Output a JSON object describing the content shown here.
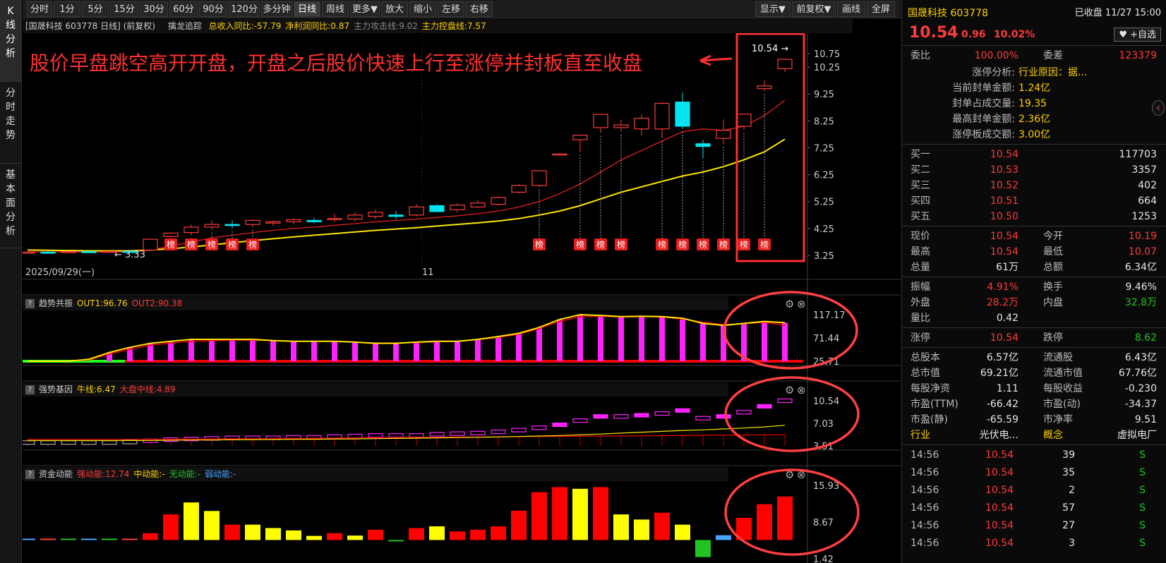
{
  "left_tabs": [
    "K线分析",
    "分时走势",
    "基本面分析"
  ],
  "toolbar": {
    "left": [
      "分时",
      "1分",
      "5分",
      "15分",
      "30分",
      "60分",
      "90分",
      "120分",
      "多分钟",
      "日线",
      "周线",
      "更多▼",
      "放大",
      "缩小",
      "左移",
      "右移"
    ],
    "active": "日线",
    "right": [
      "显示▼",
      "前复权▼",
      "画线",
      "全屏"
    ]
  },
  "main_panel": {
    "title": "[国晟科技 603778 日线] (前复权)",
    "indicator_name": "擒龙追踪",
    "stats": [
      {
        "text": "总收入同比:-57.79",
        "color": "#ffd200"
      },
      {
        "text": "净利润同比:0.87",
        "color": "#ffd200"
      },
      {
        "text": "主力攻击线:9.02",
        "color": "#888888"
      },
      {
        "text": "主力控盘线:7.57",
        "color": "#ffd200"
      }
    ],
    "y_ticks": [
      "10.75",
      "10.25",
      "9.25",
      "8.25",
      "7.25",
      "6.25",
      "5.25",
      "4.25",
      "3.25"
    ],
    "x_labels": [
      "2025/09/29(一)",
      "11"
    ],
    "annotation": "股价早盘跳空高开开盘，开盘之后股价快速上行至涨停并封板直至收盘",
    "price_high_label": "10.54",
    "price_low_label": "3.33",
    "bang_label": "榜"
  },
  "sub_panels": [
    {
      "name": "趋势共振",
      "values": [
        {
          "text": "OUT1:96.76",
          "color": "#ffd200"
        },
        {
          "text": "OUT2:90.38",
          "color": "#ff3b3b"
        }
      ],
      "y_ticks": [
        "117.17",
        "71.44",
        "25.71"
      ]
    },
    {
      "name": "强势基因",
      "values": [
        {
          "text": "牛线:6.47",
          "color": "#ffd200"
        },
        {
          "text": "大盘中线:4.89",
          "color": "#ff3b3b"
        }
      ],
      "y_ticks": [
        "10.54",
        "7.03",
        "3.51"
      ]
    },
    {
      "name": "资金动能",
      "values": [
        {
          "text": "强动能:12.74",
          "color": "#ff3b3b"
        },
        {
          "text": "中动能:-",
          "color": "#ffd200"
        },
        {
          "text": "无动能:-",
          "color": "#21c521"
        },
        {
          "text": "弱动能:-",
          "color": "#4aa3ff"
        }
      ],
      "y_ticks": [
        "15.93",
        "8.67",
        "1.42"
      ]
    }
  ],
  "chart_data": {
    "type": "candlestick",
    "ylim": [
      3.25,
      10.75
    ],
    "candles": [
      [
        3.35,
        3.38,
        3.33,
        3.37
      ],
      [
        3.37,
        3.41,
        3.34,
        3.36
      ],
      [
        3.36,
        3.4,
        3.34,
        3.39
      ],
      [
        3.39,
        3.42,
        3.35,
        3.38
      ],
      [
        3.38,
        3.42,
        3.33,
        3.4
      ],
      [
        3.4,
        3.45,
        3.35,
        3.38
      ],
      [
        3.45,
        3.85,
        3.42,
        3.85
      ],
      [
        3.95,
        4.1,
        3.9,
        4.08
      ],
      [
        4.1,
        4.4,
        4.0,
        4.3
      ],
      [
        4.3,
        4.55,
        4.2,
        4.4
      ],
      [
        4.4,
        4.55,
        4.25,
        4.38
      ],
      [
        4.4,
        4.6,
        4.3,
        4.55
      ],
      [
        4.45,
        4.55,
        4.35,
        4.5
      ],
      [
        4.5,
        4.62,
        4.4,
        4.58
      ],
      [
        4.55,
        4.65,
        4.45,
        4.5
      ],
      [
        4.58,
        4.8,
        4.5,
        4.62
      ],
      [
        4.6,
        4.85,
        4.5,
        4.75
      ],
      [
        4.7,
        4.95,
        4.6,
        4.85
      ],
      [
        4.75,
        4.9,
        4.6,
        4.7
      ],
      [
        4.75,
        5.15,
        4.7,
        5.05
      ],
      [
        5.1,
        5.15,
        4.85,
        4.88
      ],
      [
        4.95,
        5.2,
        4.85,
        5.12
      ],
      [
        5.05,
        5.3,
        5.0,
        5.2
      ],
      [
        5.15,
        5.45,
        5.1,
        5.4
      ],
      [
        5.6,
        5.9,
        5.55,
        5.85
      ],
      [
        5.85,
        6.4,
        5.8,
        6.4
      ],
      [
        6.98,
        7.05,
        6.98,
        7.02
      ],
      [
        7.55,
        7.7,
        7.1,
        7.72
      ],
      [
        8.0,
        8.45,
        7.8,
        8.49
      ],
      [
        8.0,
        8.3,
        7.85,
        8.1
      ],
      [
        7.95,
        8.5,
        7.7,
        8.35
      ],
      [
        7.95,
        8.95,
        7.6,
        8.9
      ],
      [
        8.95,
        9.3,
        7.95,
        8.05
      ],
      [
        7.4,
        7.55,
        6.85,
        7.3
      ],
      [
        7.6,
        8.3,
        7.4,
        7.9
      ],
      [
        8.05,
        8.5,
        7.9,
        8.5
      ],
      [
        9.45,
        9.75,
        9.35,
        9.55
      ],
      [
        10.19,
        10.54,
        10.07,
        10.54
      ]
    ],
    "ma_red": [
      3.38,
      3.38,
      3.38,
      3.38,
      3.38,
      3.38,
      3.45,
      3.6,
      3.75,
      3.9,
      4.0,
      4.1,
      4.18,
      4.25,
      4.3,
      4.37,
      4.43,
      4.5,
      4.55,
      4.6,
      4.66,
      4.72,
      4.8,
      4.9,
      5.05,
      5.25,
      5.55,
      5.9,
      6.35,
      6.8,
      7.15,
      7.5,
      7.85,
      7.95,
      7.9,
      8.05,
      8.45,
      9.02
    ],
    "ma_yellow": [
      3.45,
      3.44,
      3.43,
      3.42,
      3.42,
      3.42,
      3.45,
      3.5,
      3.56,
      3.64,
      3.72,
      3.8,
      3.87,
      3.94,
      4.0,
      4.06,
      4.12,
      4.18,
      4.23,
      4.28,
      4.34,
      4.4,
      4.46,
      4.53,
      4.62,
      4.75,
      4.9,
      5.1,
      5.35,
      5.6,
      5.8,
      6.0,
      6.2,
      6.35,
      6.55,
      6.8,
      7.1,
      7.57
    ],
    "bang_indices": [
      7,
      8,
      9,
      10,
      11,
      25,
      27,
      28,
      29,
      31,
      32,
      33,
      34,
      35,
      36
    ],
    "trend_bars": [
      0,
      0,
      0,
      0,
      0,
      0,
      0,
      22,
      35,
      45,
      50,
      55,
      55,
      55,
      55,
      52,
      50,
      50,
      50,
      48,
      45,
      45,
      48,
      50,
      50,
      55,
      62,
      70,
      85,
      105,
      117,
      115,
      112,
      113,
      112,
      108,
      95,
      90,
      95,
      100,
      96.76
    ],
    "trend_out1": [
      0,
      0,
      0,
      0,
      0,
      0,
      5,
      22,
      35,
      45,
      50,
      55,
      55,
      55,
      55,
      52,
      50,
      50,
      50,
      48,
      45,
      45,
      48,
      50,
      50,
      55,
      62,
      70,
      85,
      105,
      117,
      115,
      112,
      113,
      112,
      108,
      95,
      90,
      95,
      100,
      96.76
    ],
    "trend_out2": [
      0,
      0,
      0,
      0,
      0,
      0,
      3,
      18,
      30,
      40,
      46,
      50,
      52,
      53,
      53,
      52,
      50,
      50,
      50,
      48,
      46,
      46,
      47,
      49,
      50,
      54,
      60,
      68,
      82,
      100,
      112,
      113,
      111,
      112,
      111,
      106,
      98,
      92,
      94,
      98,
      90.38
    ],
    "gene_bars": [
      3.5,
      3.5,
      3.5,
      3.5,
      3.5,
      3.6,
      3.8,
      4.0,
      4.1,
      4.2,
      4.3,
      4.3,
      4.3,
      4.4,
      4.4,
      4.5,
      4.6,
      4.7,
      4.7,
      4.7,
      4.9,
      5.0,
      5.1,
      5.3,
      5.6,
      6.0,
      6.5,
      7.2,
      7.9,
      7.9,
      8.1,
      8.4,
      8.9,
      7.6,
      7.9,
      8.6,
      9.6,
      10.54
    ],
    "gene_bull": [
      3.9,
      3.9,
      3.9,
      3.9,
      3.9,
      3.9,
      3.9,
      3.95,
      3.98,
      4.0,
      4.03,
      4.06,
      4.08,
      4.1,
      4.12,
      4.15,
      4.18,
      4.22,
      4.26,
      4.3,
      4.35,
      4.4,
      4.45,
      4.5,
      4.58,
      4.66,
      4.75,
      4.85,
      5.0,
      5.15,
      5.3,
      5.45,
      5.6,
      5.7,
      5.85,
      6.0,
      6.2,
      6.47
    ],
    "gene_mid": [
      4.1,
      4.1,
      4.1,
      4.1,
      4.1,
      4.1,
      4.1,
      4.12,
      4.15,
      4.17,
      4.2,
      4.22,
      4.25,
      4.27,
      4.3,
      4.32,
      4.35,
      4.38,
      4.4,
      4.43,
      4.45,
      4.48,
      4.5,
      4.52,
      4.55,
      4.58,
      4.6,
      4.62,
      4.65,
      4.68,
      4.7,
      4.72,
      4.75,
      4.78,
      4.8,
      4.83,
      4.86,
      4.89
    ],
    "flow_bars": [
      0.4,
      0.4,
      0.4,
      0.4,
      0.4,
      0.4,
      2,
      7.5,
      11,
      8.5,
      4.5,
      4.5,
      3.5,
      2.8,
      1.2,
      2,
      1.3,
      3,
      0,
      3.5,
      4,
      2.5,
      3,
      4,
      8.6,
      14,
      15.5,
      15,
      15.5,
      7.5,
      6,
      8,
      4.5,
      -5,
      1.4,
      6.5,
      10.5,
      12.74
    ],
    "flow_colors": [
      "#4aa3ff",
      "#ff3b3b",
      "#21c521",
      "#4aa3ff",
      "#21c521",
      "#ff3b3b",
      "#ff0000",
      "#ff0000",
      "#ffff00",
      "#ffff00",
      "#ff0000",
      "#ffff00",
      "#ffff00",
      "#ffff00",
      "#ffff00",
      "#ff0000",
      "#ffff00",
      "#ff0000",
      "#21c521",
      "#ff0000",
      "#ffff00",
      "#ff0000",
      "#ff0000",
      "#ff0000",
      "#ff0000",
      "#ff0000",
      "#ff0000",
      "#ffff00",
      "#ff0000",
      "#ffff00",
      "#ffff00",
      "#ff0000",
      "#ffff00",
      "#21c521",
      "#4aa3ff",
      "#ff0000",
      "#ff0000",
      "#ff0000"
    ]
  },
  "right_panel": {
    "title": "国晟科技 603778",
    "status": "已收盘 11/27 15:00",
    "price": "10.54",
    "change": "0.96",
    "pct": "10.02%",
    "watch_btn": "+自选",
    "weibi_label": "委比",
    "weibi": "100.00%",
    "weicha_label": "委差",
    "weicha": "123379",
    "limit_analysis": [
      {
        "label": "涨停分析:",
        "value": "行业原因：据..."
      },
      {
        "label": "当前封单金额:",
        "value": "1.24亿"
      },
      {
        "label": "封单占成交量:",
        "value": "19.35"
      },
      {
        "label": "最高封单金额:",
        "value": "2.36亿"
      },
      {
        "label": "涨停板成交额:",
        "value": "3.00亿"
      }
    ],
    "bids": [
      {
        "label": "买一",
        "price": "10.54",
        "vol": "117703"
      },
      {
        "label": "买二",
        "price": "10.53",
        "vol": "3357"
      },
      {
        "label": "买三",
        "price": "10.52",
        "vol": "402"
      },
      {
        "label": "买四",
        "price": "10.51",
        "vol": "664"
      },
      {
        "label": "买五",
        "price": "10.50",
        "vol": "1253"
      }
    ],
    "quote": [
      {
        "l1": "现价",
        "v1": "10.54",
        "c1": "red",
        "l2": "今开",
        "v2": "10.19",
        "c2": "red"
      },
      {
        "l1": "最高",
        "v1": "10.54",
        "c1": "red",
        "l2": "最低",
        "v2": "10.07",
        "c2": "red"
      },
      {
        "l1": "总量",
        "v1": "61万",
        "c1": "wht",
        "l2": "总额",
        "v2": "6.34亿",
        "c2": "wht"
      }
    ],
    "quote2": [
      {
        "l1": "振幅",
        "v1": "4.91%",
        "c1": "red",
        "l2": "换手",
        "v2": "9.46%",
        "c2": "wht"
      },
      {
        "l1": "外盘",
        "v1": "28.2万",
        "c1": "red",
        "l2": "内盘",
        "v2": "32.8万",
        "c2": "green"
      },
      {
        "l1": "量比",
        "v1": "0.42",
        "c1": "wht",
        "l2": "",
        "v2": "",
        "c2": "wht"
      }
    ],
    "limit_row": {
      "l1": "涨停",
      "v1": "10.54",
      "l2": "跌停",
      "v2": "8.62"
    },
    "fund": [
      {
        "l1": "总股本",
        "v1": "6.57亿",
        "l2": "流通股",
        "v2": "6.43亿"
      },
      {
        "l1": "总市值",
        "v1": "69.21亿",
        "l2": "流通市值",
        "v2": "67.76亿"
      },
      {
        "l1": "每股净资",
        "v1": "1.11",
        "l2": "每股收益",
        "v2": "-0.230"
      },
      {
        "l1": "市盈(TTM)",
        "v1": "-66.42",
        "l2": "市盈(动)",
        "v2": "-34.37"
      },
      {
        "l1": "市盈(静)",
        "v1": "-65.59",
        "l2": "市净率",
        "v2": "9.51"
      }
    ],
    "industry": {
      "l1": "行业",
      "v1": "光伏电...",
      "l2": "概念",
      "v2": "虚拟电厂"
    },
    "ticks": [
      {
        "time": "14:56",
        "price": "10.54",
        "vol": "39",
        "side": "S"
      },
      {
        "time": "14:56",
        "price": "10.54",
        "vol": "35",
        "side": "S"
      },
      {
        "time": "14:56",
        "price": "10.54",
        "vol": "2",
        "side": "S"
      },
      {
        "time": "14:56",
        "price": "10.54",
        "vol": "57",
        "side": "S"
      },
      {
        "time": "14:56",
        "price": "10.54",
        "vol": "27",
        "side": "S"
      },
      {
        "time": "14:56",
        "price": "10.54",
        "vol": "3",
        "side": "S"
      }
    ]
  }
}
